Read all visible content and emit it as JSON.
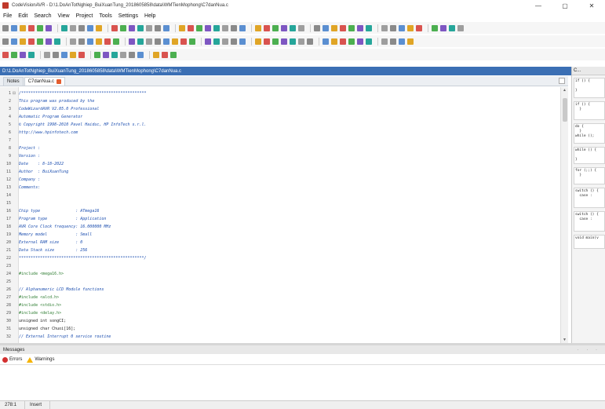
{
  "window": {
    "title": "CodeVisionAVR - D:\\1.DoAnTotNghiep_BuiXuanTung_2018605858\\data\\WMTienMophong\\C7danNua.c",
    "controls": [
      "—",
      "▢",
      "✕"
    ]
  },
  "menu": [
    "File",
    "Edit",
    "Search",
    "View",
    "Project",
    "Tools",
    "Settings",
    "Help"
  ],
  "path": "D:\\1.DoAnTotNghiep_BuiXuanTung_2018605858\\data\\WMTienMophong\\C7danNua.c",
  "tabs": [
    {
      "label": "Notes",
      "active": false
    },
    {
      "label": "C7danNua.c",
      "active": true
    }
  ],
  "code_lines": [
    {
      "n": "1",
      "text": "/*****************************************************",
      "kind": "comment",
      "fold": "⊟"
    },
    {
      "n": "2",
      "text": "This program was produced by the",
      "kind": "comment"
    },
    {
      "n": "3",
      "text": "CodeWizardAVR V2.05.0 Professional",
      "kind": "comment"
    },
    {
      "n": "4",
      "text": "Automatic Program Generator",
      "kind": "comment"
    },
    {
      "n": "5",
      "text": "© Copyright 1998-2010 Pavel Haiduc, HP InfoTech s.r.l.",
      "kind": "comment"
    },
    {
      "n": "6",
      "text": "http://www.hpinfotech.com",
      "kind": "comment"
    },
    {
      "n": "7",
      "text": "",
      "kind": "comment"
    },
    {
      "n": "8",
      "text": "Project :",
      "kind": "comment"
    },
    {
      "n": "9",
      "text": "Version :",
      "kind": "comment"
    },
    {
      "n": "10",
      "text": "Date    : 8-18-2022",
      "kind": "comment"
    },
    {
      "n": "11",
      "text": "Author  : BuiXuanTung",
      "kind": "comment"
    },
    {
      "n": "12",
      "text": "Company :",
      "kind": "comment"
    },
    {
      "n": "13",
      "text": "Comments:",
      "kind": "comment"
    },
    {
      "n": "14",
      "text": "",
      "kind": "comment"
    },
    {
      "n": "15",
      "text": "",
      "kind": "comment"
    },
    {
      "n": "16",
      "text": "Chip type               : ATmega16",
      "kind": "comment"
    },
    {
      "n": "17",
      "text": "Program type            : Application",
      "kind": "comment"
    },
    {
      "n": "18",
      "text": "AVR Core Clock frequency: 16.000000 MHz",
      "kind": "comment"
    },
    {
      "n": "19",
      "text": "Memory model            : Small",
      "kind": "comment"
    },
    {
      "n": "20",
      "text": "External RAM size       : 0",
      "kind": "comment"
    },
    {
      "n": "21",
      "text": "Data Stack size         : 256",
      "kind": "comment"
    },
    {
      "n": "22",
      "text": "*****************************************************/",
      "kind": "comment"
    },
    {
      "n": "23",
      "text": "",
      "kind": "code"
    },
    {
      "n": "24",
      "text": "#include <mega16.h>",
      "kind": "pre"
    },
    {
      "n": "25",
      "text": "",
      "kind": "code"
    },
    {
      "n": "26",
      "text": "// Alphanumeric LCD Module functions",
      "kind": "comment"
    },
    {
      "n": "27",
      "text": "#include <alcd.h>",
      "kind": "pre"
    },
    {
      "n": "28",
      "text": "#include <stdio.h>",
      "kind": "pre"
    },
    {
      "n": "29",
      "text": "#include <delay.h>",
      "kind": "pre"
    },
    {
      "n": "30",
      "text": "unsigned int songCI;",
      "kind": "code"
    },
    {
      "n": "31",
      "text": "unsigned char Chuoi[16];",
      "kind": "code"
    },
    {
      "n": "32",
      "text": "// External Interrupt 0 service routine",
      "kind": "comment"
    }
  ],
  "right_panel": {
    "header": "C...",
    "snippets": [
      "if () {\n\n}",
      "if () {\n  }\n",
      "do {\n  }\nwhile ();",
      "while () {\n\n}",
      "for (;;) {\n  }",
      "switch () {\n  case :\n",
      "switch () {\n  case :\n",
      "void main(v"
    ]
  },
  "messages": {
    "header": "Messages",
    "tabs": [
      {
        "label": "Errors",
        "icon": "error-icon"
      },
      {
        "label": "Warnings",
        "icon": "warning-icon"
      }
    ]
  },
  "status": {
    "position": "278:1",
    "mode": "Insert"
  },
  "colors": {
    "path_bar": "#3b6fb4",
    "comment": "#1d4fb0",
    "preprocessor": "#2e7d32"
  }
}
